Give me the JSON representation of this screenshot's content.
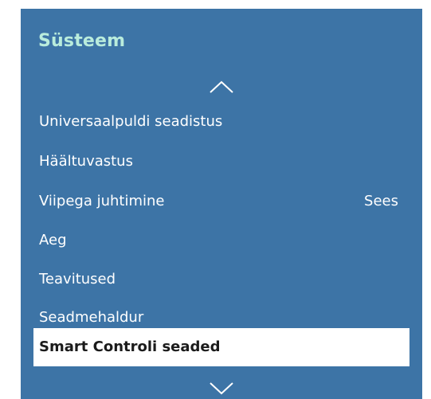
{
  "menu": {
    "title": "Süsteem",
    "scroll_up_icon": "chevron-up-icon",
    "scroll_down_icon": "chevron-down-icon",
    "items": [
      {
        "label": "Universaalpuldi seadistus",
        "value": ""
      },
      {
        "label": "Häältuvastus",
        "value": ""
      },
      {
        "label": "Viipega juhtimine",
        "value": "Sees"
      },
      {
        "label": "Aeg",
        "value": ""
      },
      {
        "label": "Teavitused",
        "value": ""
      },
      {
        "label": "Seadmehaldur",
        "value": ""
      },
      {
        "label": "Smart Controli seaded",
        "value": ""
      }
    ],
    "selected_item": "Smart Controli seaded"
  },
  "colors": {
    "panel_background": "#3d74a6",
    "title": "#b9ecdc",
    "item_text": "#ffffff",
    "selected_background": "#ffffff",
    "selected_text": "#1b1b1b"
  }
}
